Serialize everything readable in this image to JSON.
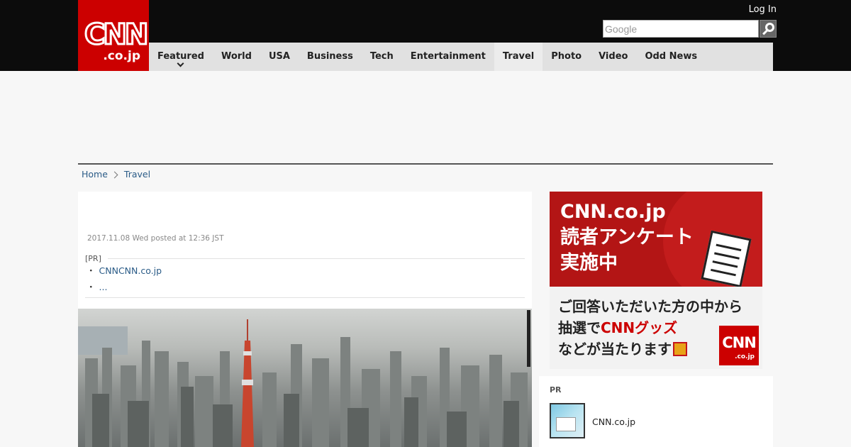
{
  "header": {
    "logo": {
      "main": "CNN",
      "sub": ".co.jp"
    },
    "login_label": "Log In",
    "search": {
      "placeholder": "Google",
      "button_icon": "search-icon"
    }
  },
  "nav": {
    "items": [
      {
        "label": "Featured",
        "has_dropdown": true
      },
      {
        "label": "World"
      },
      {
        "label": "USA"
      },
      {
        "label": "Business"
      },
      {
        "label": "Tech"
      },
      {
        "label": "Entertainment"
      },
      {
        "label": "Travel",
        "active": true
      },
      {
        "label": "Photo"
      },
      {
        "label": "Video"
      },
      {
        "label": "Odd News"
      }
    ]
  },
  "breadcrumb": {
    "home": "Home",
    "current": "Travel"
  },
  "article": {
    "timestamp": "2017.11.08 Wed posted at 12:36 JST",
    "pr_label": "[PR]",
    "pr_links": [
      {
        "bullet": "・",
        "text": "CNNCNN.co.jp"
      },
      {
        "bullet": "・",
        "text": "..."
      }
    ]
  },
  "sidebar": {
    "survey_banner": {
      "line1": "CNN.co.jp",
      "line2": "読者アンケート",
      "line3": "実施中",
      "line4": "ご回答いただいた方の中から",
      "line5_a": "抽選で",
      "line5_b": "CNNグッズ",
      "line6": "などが当たります",
      "logo_main": "CNN",
      "logo_sub": ".co.jp"
    },
    "pr_box": {
      "title": "PR",
      "item_text": "CNN.co.jp"
    }
  },
  "colors": {
    "brand_red": "#cc0000",
    "topbar": "#0c0c0c",
    "nav_bg": "#e1e1e1",
    "link": "#2a5b87"
  }
}
